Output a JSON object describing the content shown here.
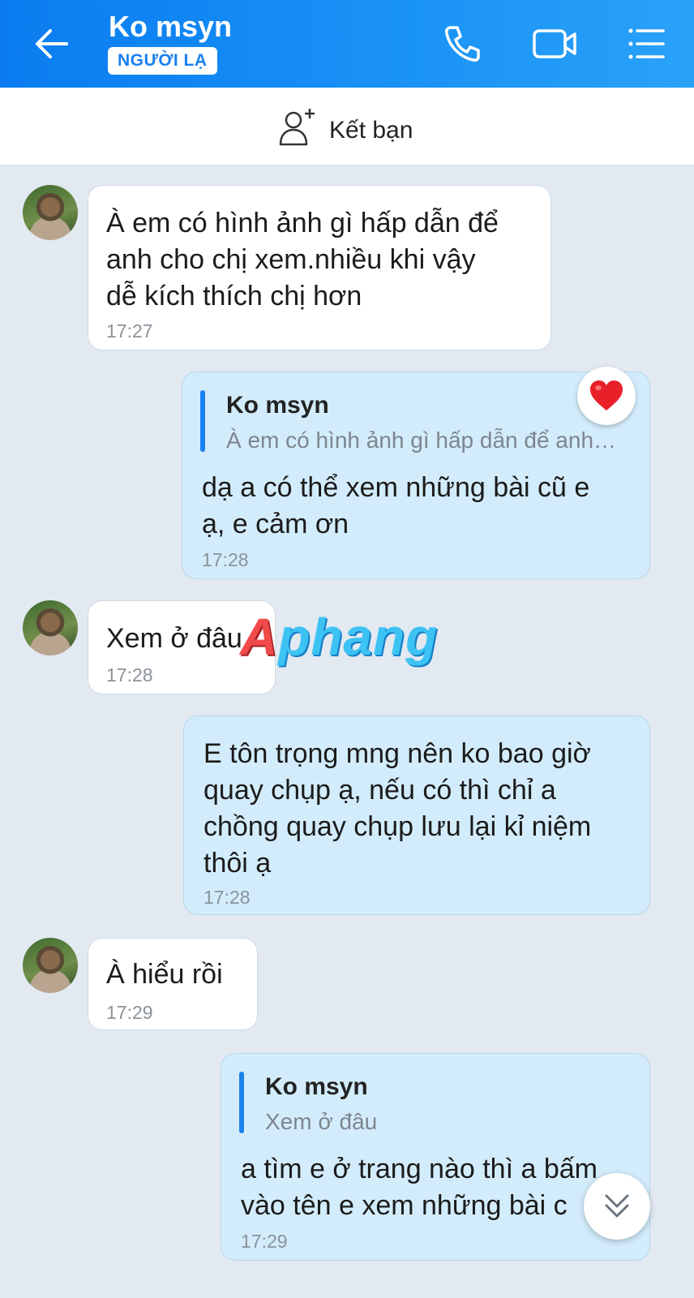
{
  "header": {
    "title": "Ko msyn",
    "badge": "NGƯỜI LẠ",
    "icons": [
      "back-arrow-icon",
      "phone-icon",
      "video-call-icon",
      "menu-list-icon"
    ]
  },
  "friend_bar": {
    "label": "Kết bạn",
    "icon": "add-friend-icon"
  },
  "messages": [
    {
      "side": "in",
      "text_lines": [
        "À em có hình ảnh gì hấp dẫn để",
        "anh cho chị xem.nhiều khi vậy",
        "dễ kích thích chị hơn"
      ],
      "time": "17:27"
    },
    {
      "side": "out",
      "quote_name": "Ko msyn",
      "quote_text": "À em có hình ảnh gì hấp dẫn để anh…",
      "text_lines": [
        "dạ a có thể xem những bài cũ e",
        "ạ, e cảm ơn"
      ],
      "time": "17:28",
      "reaction": "heart"
    },
    {
      "side": "in",
      "text_lines": [
        "Xem ở đâu"
      ],
      "time": "17:28"
    },
    {
      "side": "out",
      "text_lines": [
        "E tôn trọng mng nên ko bao giờ",
        "quay chụp ạ, nếu có thì chỉ a",
        "chồng quay chụp lưu lại kỉ niệm",
        "thôi ạ"
      ],
      "time": "17:28"
    },
    {
      "side": "in",
      "text_lines": [
        "À hiểu rồi"
      ],
      "time": "17:29"
    },
    {
      "side": "out",
      "quote_name": "Ko msyn",
      "quote_text": "Xem ở đâu",
      "text_lines": [
        "a tìm e ở trang nào thì a bấm",
        "vào tên e xem những bài c"
      ],
      "time": "17:29"
    }
  ],
  "watermark": {
    "first": "A",
    "rest": "phang"
  },
  "colors": {
    "header": "#1a8ff5",
    "incoming": "#ffffff",
    "outgoing": "#d3ecfb",
    "background": "#e2e9f1",
    "quote_bar": "#1a82ee"
  }
}
